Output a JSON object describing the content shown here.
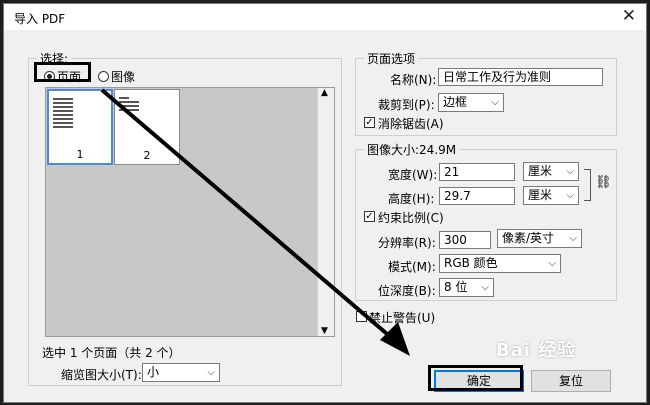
{
  "window": {
    "title": "导入 PDF",
    "close_icon": "✕"
  },
  "select_group": {
    "legend": "选择:",
    "radio_page": "页面",
    "radio_image": "图像",
    "thumbnails": [
      {
        "number": "1"
      },
      {
        "number": "2"
      }
    ],
    "status": "选中 1 个页面（共 2 个）",
    "thumb_size_label": "缩览图大小(T):",
    "thumb_size_value": "小"
  },
  "page_options": {
    "legend": "页面选项",
    "name_label": "名称(N):",
    "name_value": "日常工作及行为准则",
    "crop_label": "裁剪到(P):",
    "crop_value": "边框",
    "antialias_label": "消除锯齿(A)",
    "antialias_checked": true
  },
  "image_size": {
    "legend": "图像大小:24.9M",
    "width_label": "宽度(W):",
    "width_value": "21",
    "width_unit": "厘米",
    "height_label": "高度(H):",
    "height_value": "29.7",
    "height_unit": "厘米",
    "constrain_label": "约束比例(C)",
    "constrain_checked": true,
    "resolution_label": "分辨率(R):",
    "resolution_value": "300",
    "resolution_unit": "像素/英寸",
    "mode_label": "模式(M):",
    "mode_value": "RGB 颜色",
    "depth_label": "位深度(B):",
    "depth_value": "8 位"
  },
  "suppress_warnings_label": "禁止警告(U)",
  "buttons": {
    "ok": "确定",
    "reset": "复位"
  },
  "watermark": "Bai 经验"
}
